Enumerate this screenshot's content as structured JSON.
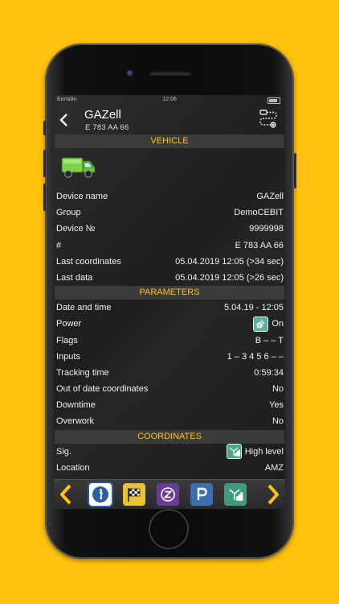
{
  "status_bar": {
    "carrier": "Билайн",
    "time": "12:06"
  },
  "header": {
    "title": "GAZell",
    "subtitle": "E 783 AA 66"
  },
  "icons": {
    "back": "chevron-left-icon",
    "route": "route-icon",
    "vehicle": "truck-icon",
    "power": "plug-icon",
    "signal": "antenna-icon",
    "toolbar": [
      "info-icon",
      "checkered-flag-icon",
      "z-icon",
      "parking-icon",
      "antenna-icon"
    ]
  },
  "colors": {
    "accent": "#ffc20e",
    "section_bg": "#3b3b3b",
    "text": "#f0f0f0"
  },
  "sections": {
    "vehicle": {
      "title": "VEHICLE",
      "rows": [
        {
          "label": "Device name",
          "value": "GAZell"
        },
        {
          "label": "Group",
          "value": "DemoCEBIT"
        },
        {
          "label": "Device №",
          "value": "9999998"
        },
        {
          "label": "#",
          "value": "E 783 AA 66"
        },
        {
          "label": "Last coordinates",
          "value": "05.04.2019 12:05 (>34 sec)"
        },
        {
          "label": "Last data",
          "value": "05.04.2019 12:05 (>26 sec)"
        }
      ]
    },
    "parameters": {
      "title": "PARAMETERS",
      "rows": [
        {
          "label": "Date and time",
          "value": "5.04.19 - 12:05"
        },
        {
          "label": "Power",
          "value": "On"
        },
        {
          "label": "Flags",
          "value": "B – – T"
        },
        {
          "label": "Inputs",
          "value": "1 – 3 4 5 6 – –"
        },
        {
          "label": "Tracking time",
          "value": "0:59:34"
        },
        {
          "label": "Out of date coordinates",
          "value": "No"
        },
        {
          "label": "Downtime",
          "value": "Yes"
        },
        {
          "label": "Overwork",
          "value": "No"
        }
      ]
    },
    "coordinates": {
      "title": "COORDINATES",
      "rows": [
        {
          "label": "Sig.",
          "value": "High level"
        },
        {
          "label": "Location",
          "value": "AMZ"
        }
      ]
    }
  }
}
